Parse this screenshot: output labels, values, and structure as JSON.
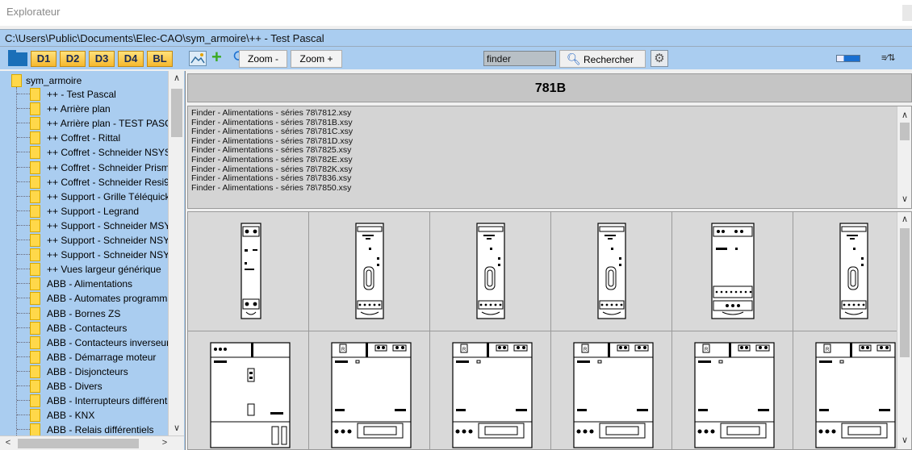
{
  "window": {
    "title": "Explorateur"
  },
  "path": "C:\\Users\\Public\\Documents\\Elec-CAO\\sym_armoire\\++ - Test Pascal",
  "toolbar": {
    "d_buttons": [
      "D1",
      "D2",
      "D3",
      "D4",
      "BL"
    ],
    "zoom_out_label": "Zoom -",
    "zoom_in_label": "Zoom +",
    "search_value": "finder",
    "search_button_label": "Rechercher",
    "icons": [
      "folder-icon",
      "image-icon",
      "add-icon",
      "refresh-icon",
      "search-icon",
      "settings-icon",
      "thumbnail-size-icon",
      "sort-icon"
    ]
  },
  "tree": {
    "root": "sym_armoire",
    "items": [
      "++ - Test Pascal",
      "++ Arrière plan",
      "++ Arrière plan - TEST PASC",
      "++ Coffret - Rittal",
      "++ Coffret - Schneider NSYS",
      "++ Coffret - Schneider Prisma",
      "++ Coffret - Schneider Resi9",
      "++ Support  - Grille Téléquick",
      "++ Support - Legrand",
      "++ Support - Schneider MSY",
      "++ Support - Schneider NSY",
      "++ Support - Schneider NSY",
      "++ Vues largeur générique",
      "ABB - Alimentations",
      "ABB - Automates programma",
      "ABB - Bornes ZS",
      "ABB - Contacteurs",
      "ABB - Contacteurs inverseur",
      "ABB - Démarrage moteur",
      "ABB - Disjoncteurs",
      "ABB - Divers",
      "ABB - Interrupteurs différenti",
      "ABB - KNX",
      "ABB - Relais différentiels"
    ]
  },
  "selected_symbol": "781B",
  "file_list": [
    "Finder - Alimentations - séries 78\\7812.xsy",
    "Finder - Alimentations - séries 78\\781B.xsy",
    "Finder - Alimentations - séries 78\\781C.xsy",
    "Finder - Alimentations - séries 78\\781D.xsy",
    "Finder - Alimentations - séries 78\\7825.xsy",
    "Finder - Alimentations - séries 78\\782E.xsy",
    "Finder - Alimentations - séries 78\\782K.xsy",
    "Finder - Alimentations - séries 78\\7836.xsy",
    "Finder - Alimentations - séries 78\\7850.xsy"
  ]
}
